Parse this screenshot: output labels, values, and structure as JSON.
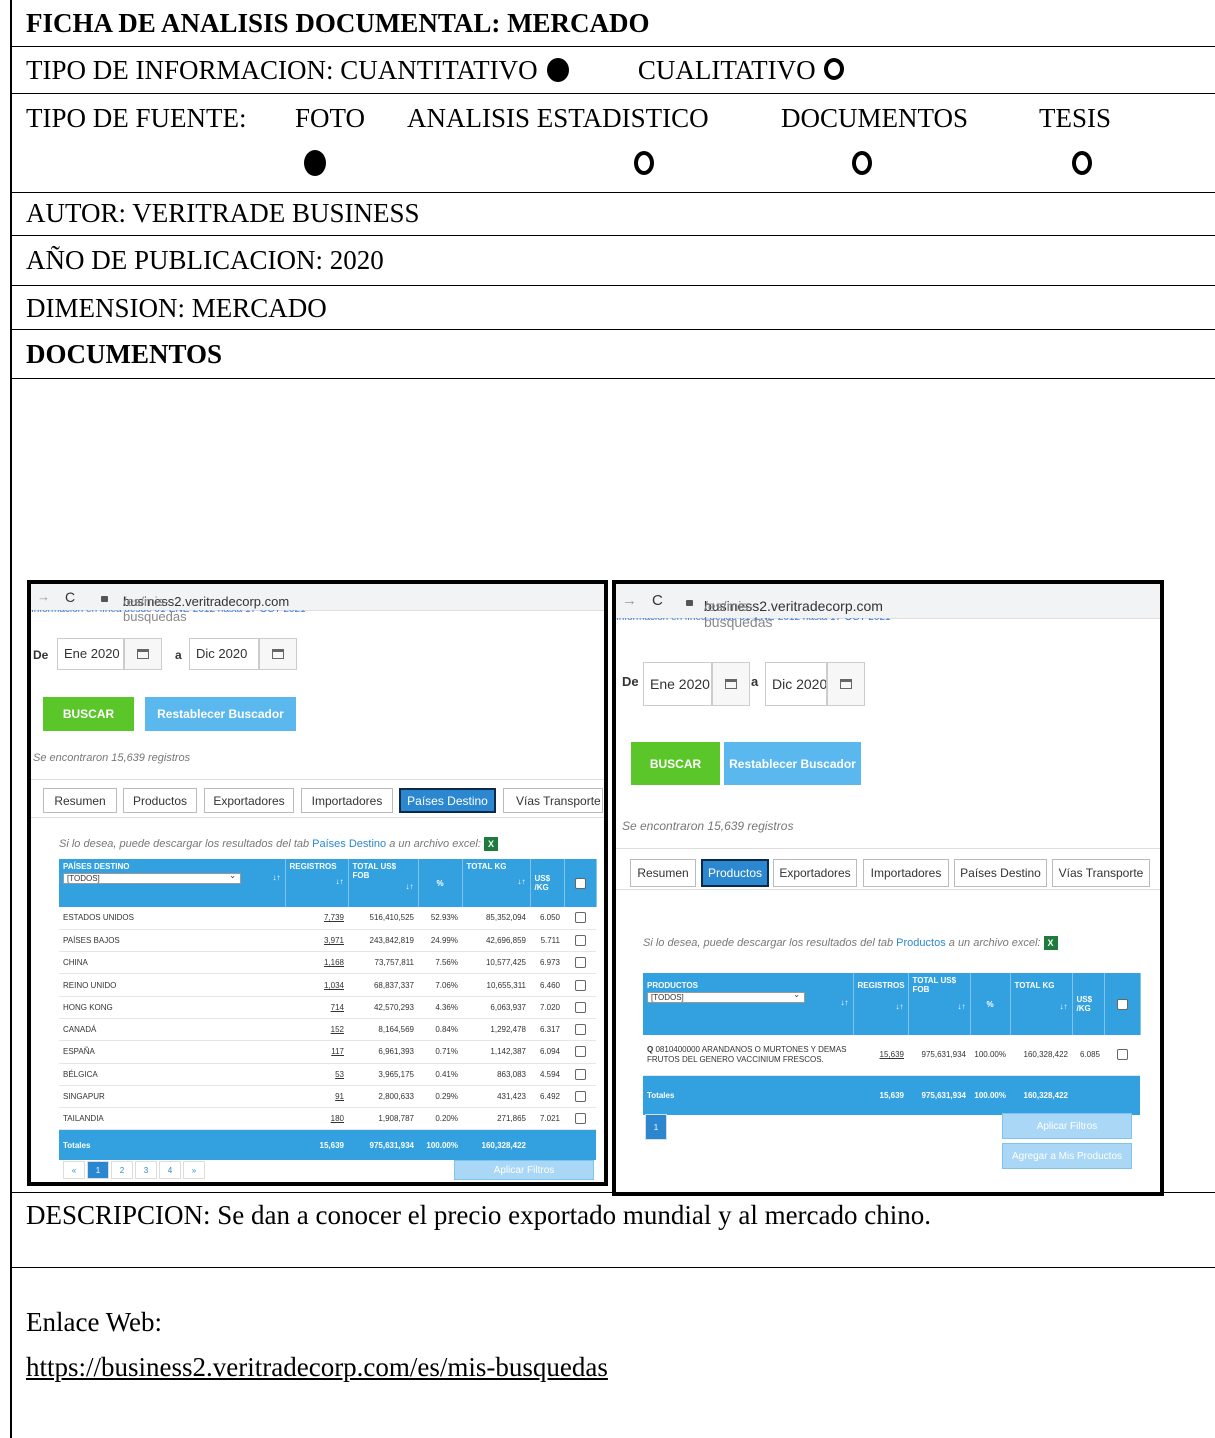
{
  "form": {
    "title": "FICHA DE ANALISIS DOCUMENTAL: MERCADO",
    "info_type": {
      "label": "TIPO DE INFORMACION:",
      "option1": "CUANTITATIVO",
      "option2": "CUALITATIVO",
      "selected": "CUANTITATIVO"
    },
    "source_type": {
      "label": "TIPO DE FUENTE:",
      "options": [
        "FOTO",
        "ANALISIS ESTADISTICO",
        "DOCUMENTOS",
        "TESIS"
      ],
      "selected": "FOTO"
    },
    "author": "AUTOR: VERITRADE BUSINESS",
    "year": "AÑO DE PUBLICACION: 2020",
    "dimension": "DIMENSION: MERCADO",
    "documents_heading": "DOCUMENTOS",
    "description": "DESCRIPCION: Se dan a conocer el precio exportado mundial y al mercado chino.",
    "web_label": "Enlace Web:",
    "web_url": "https://business2.veritradecorp.com/es/mis-busquedas"
  },
  "shot_left": {
    "url_host": "business2.veritradecorp.com",
    "url_path": "/es/mis-busquedas",
    "info_line": "Información en línea desde 01-ENE-2012 hasta 17-OCT-2021",
    "de": "De",
    "from": "Ene 2020",
    "a": "a",
    "to": "Dic 2020",
    "buscar": "BUSCAR",
    "reset": "Restablecer Buscador",
    "found": "Se encontraron 15,639 registros",
    "tabs": [
      "Resumen",
      "Productos",
      "Exportadores",
      "Importadores",
      "Países Destino",
      "Vías Transporte"
    ],
    "active_tab": "Países Destino",
    "download_pre": "Si lo desea, puede descargar los resultados del tab",
    "download_tab": "Países Destino",
    "download_post": "a un archivo excel:",
    "excel_icon": "X",
    "headers": [
      "PAÍSES DESTINO",
      "REGISTROS",
      "TOTAL US$ FOB",
      "%",
      "TOTAL KG",
      "US$ /KG"
    ],
    "filter_value": "[TODOS]",
    "sort_symbol": "↓↑",
    "rows": [
      [
        "ESTADOS UNIDOS",
        "7,739",
        "516,410,525",
        "52.93%",
        "85,352,094",
        "6.050"
      ],
      [
        "PAÍSES BAJOS",
        "3,971",
        "243,842,819",
        "24.99%",
        "42,696,859",
        "5.711"
      ],
      [
        "CHINA",
        "1,168",
        "73,757,811",
        "7.56%",
        "10,577,425",
        "6.973"
      ],
      [
        "REINO UNIDO",
        "1,034",
        "68,837,337",
        "7.06%",
        "10,655,311",
        "6.460"
      ],
      [
        "HONG KONG",
        "714",
        "42,570,293",
        "4.36%",
        "6,063,937",
        "7.020"
      ],
      [
        "CANADÁ",
        "152",
        "8,164,569",
        "0.84%",
        "1,292,478",
        "6.317"
      ],
      [
        "ESPAÑA",
        "117",
        "6,961,393",
        "0.71%",
        "1,142,387",
        "6.094"
      ],
      [
        "BÉLGICA",
        "53",
        "3,965,175",
        "0.41%",
        "863,083",
        "4.594"
      ],
      [
        "SINGAPUR",
        "91",
        "2,800,633",
        "0.29%",
        "431,423",
        "6.492"
      ],
      [
        "TAILANDIA",
        "180",
        "1,908,787",
        "0.20%",
        "271,865",
        "7.021"
      ]
    ],
    "totals": [
      "Totales",
      "15,639",
      "975,631,934",
      "100.00%",
      "160,328,422"
    ],
    "pages": [
      "«",
      "1",
      "2",
      "3",
      "4",
      "»"
    ],
    "apply": "Aplicar Filtros"
  },
  "shot_right": {
    "url_host": "business2.veritradecorp.com",
    "url_path": "/es/mis-busquedas",
    "info_line": "Información en línea desde 01-ENE-2012 hasta 17-OCT-2021",
    "de": "De",
    "from": "Ene 2020",
    "a": "a",
    "to": "Dic 2020",
    "buscar": "BUSCAR",
    "reset": "Restablecer Buscador",
    "found": "Se encontraron 15,639 registros",
    "tabs": [
      "Resumen",
      "Productos",
      "Exportadores",
      "Importadores",
      "Países Destino",
      "Vías Transporte"
    ],
    "active_tab": "Productos",
    "download_pre": "Si lo desea, puede descargar los resultados del tab",
    "download_tab": "Productos",
    "download_post": "a un archivo excel:",
    "excel_icon": "X",
    "headers": [
      "PRODUCTOS",
      "REGISTROS",
      "TOTAL US$ FOB",
      "%",
      "TOTAL KG",
      "US$ /KG"
    ],
    "filter_value": "[TODOS]",
    "sort_symbol": "↓↑",
    "search_icon": "Q",
    "row": [
      "0810400000 ARANDANOS O MURTONES Y DEMAS FRUTOS DEL GENERO VACCINIUM FRESCOS.",
      "15,639",
      "975,631,934",
      "100.00%",
      "160,328,422",
      "6.085"
    ],
    "totals": [
      "Totales",
      "15,639",
      "975,631,934",
      "100.00%",
      "160,328,422"
    ],
    "page": "1",
    "apply": "Aplicar Filtros",
    "add": "Agregar a Mis Productos"
  }
}
